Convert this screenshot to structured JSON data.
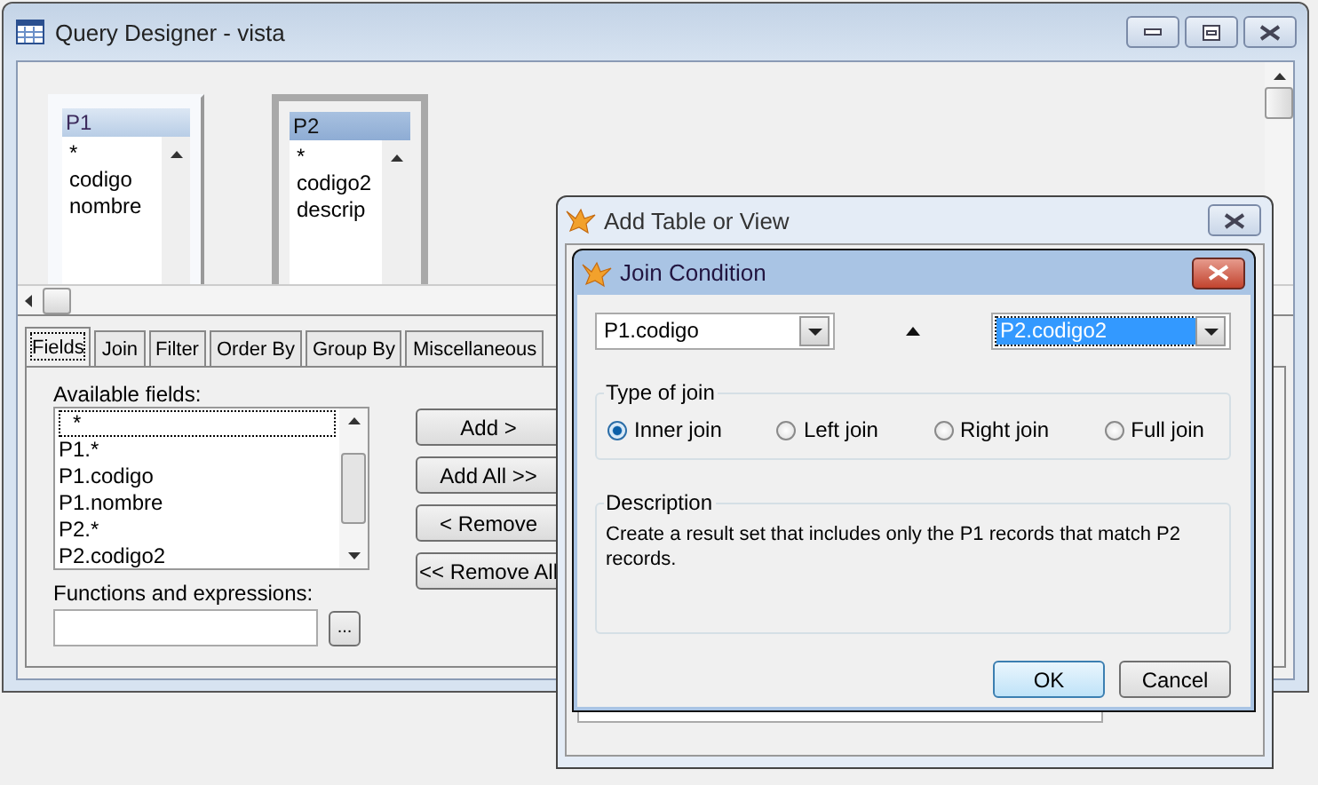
{
  "window": {
    "title": "Query Designer - vista"
  },
  "tables": [
    {
      "name": "P1",
      "selected": false,
      "fields": [
        "*",
        "codigo",
        "nombre"
      ]
    },
    {
      "name": "P2",
      "selected": true,
      "fields": [
        "*",
        "codigo2",
        "descrip"
      ]
    }
  ],
  "tabs": [
    {
      "label": "Fields",
      "selected": true
    },
    {
      "label": "Join",
      "selected": false
    },
    {
      "label": "Filter",
      "selected": false
    },
    {
      "label": "Order By",
      "selected": false
    },
    {
      "label": "Group By",
      "selected": false
    },
    {
      "label": "Miscellaneous",
      "selected": false
    }
  ],
  "fields_panel": {
    "available_label": "Available fields:",
    "available": [
      {
        "text": "*",
        "focused": true
      },
      {
        "text": "P1.*",
        "focused": false
      },
      {
        "text": "P1.codigo",
        "focused": false
      },
      {
        "text": "P1.nombre",
        "focused": false
      },
      {
        "text": "P2.*",
        "focused": false
      },
      {
        "text": "P2.codigo2",
        "focused": false
      }
    ],
    "buttons": [
      "Add >",
      "Add All >>",
      "< Remove",
      "<< Remove All"
    ],
    "functions_label": "Functions and expressions:",
    "browse_button": "..."
  },
  "add_table_dialog": {
    "title": "Add Table or View"
  },
  "join_dialog": {
    "title": "Join Condition",
    "left_field": {
      "value": "P1.codigo",
      "selected": false
    },
    "right_field": {
      "value": "P2.codigo2",
      "selected": true
    },
    "join_type_label": "Type of join",
    "join_types": [
      {
        "label": "Inner join",
        "selected": true
      },
      {
        "label": "Left join",
        "selected": false
      },
      {
        "label": "Right join",
        "selected": false
      },
      {
        "label": "Full join",
        "selected": false
      }
    ],
    "description_label": "Description",
    "description": "Create a result set that includes only the P1 records that match P2 records.",
    "buttons": [
      {
        "label": "OK",
        "default": true
      },
      {
        "label": "Cancel",
        "default": false
      }
    ]
  }
}
